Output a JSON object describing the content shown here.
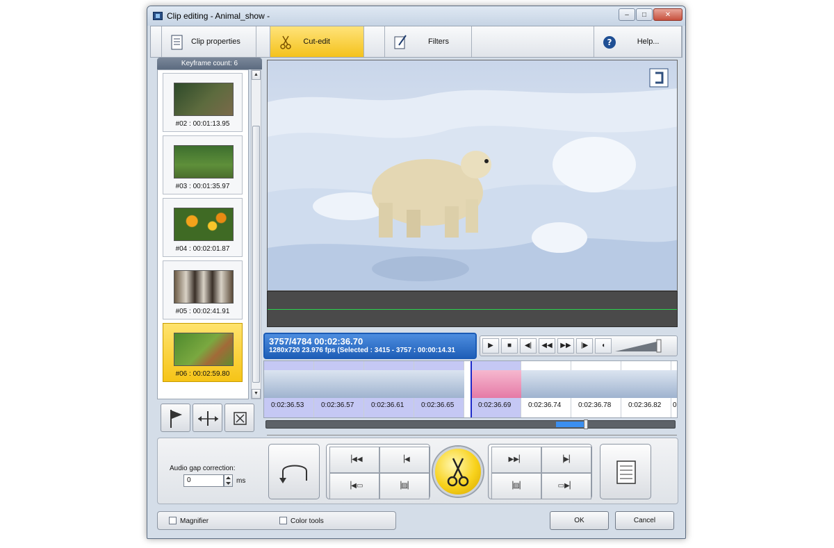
{
  "window": {
    "title": "Clip editing - Animal_show -"
  },
  "toolbar": {
    "clip_properties": "Clip properties",
    "cut_edit": "Cut-edit",
    "filters": "Filters",
    "help": "Help..."
  },
  "keyframes": {
    "header": "Keyframe count: 6",
    "items": [
      {
        "label": "#02 : 00:01:13.95",
        "thumb": "wolf"
      },
      {
        "label": "#03 : 00:01:35.97",
        "thumb": "moose"
      },
      {
        "label": "#04 : 00:02:01.87",
        "thumb": "flowers"
      },
      {
        "label": "#05 : 00:02:41.91",
        "thumb": "raccoons"
      },
      {
        "label": "#06 : 00:02:59.80",
        "thumb": "deer"
      }
    ]
  },
  "info": {
    "main": "3757/4784  00:02:36.70",
    "sub": "1280x720 23.976  fps  (Selected : 3415 - 3757 : 00:00:14.31"
  },
  "timeline": {
    "frames": [
      {
        "time": "0:02:36.53",
        "selected": true
      },
      {
        "time": "0:02:36.57",
        "selected": true
      },
      {
        "time": "0:02:36.61",
        "selected": true
      },
      {
        "time": "0:02:36.65",
        "selected": true
      },
      {
        "time": "0:02:36.69",
        "selected": true,
        "highlight": true
      },
      {
        "time": "0:02:36.74",
        "selected": false
      },
      {
        "time": "0:02:36.78",
        "selected": false
      },
      {
        "time": "0:02:36.82",
        "selected": false
      },
      {
        "time": "0",
        "selected": false
      }
    ]
  },
  "audio_gap": {
    "label": "Audio gap correction:",
    "value": "0",
    "unit": "ms"
  },
  "footer": {
    "magnifier": "Magnifier",
    "color_tools": "Color tools",
    "ok": "OK",
    "cancel": "Cancel"
  },
  "colors": {
    "accent_yellow": "#f4c21c",
    "selection_blue": "#3b8ff0",
    "frame_range": "#c5c8f4",
    "playhead": "#1b29c9"
  }
}
